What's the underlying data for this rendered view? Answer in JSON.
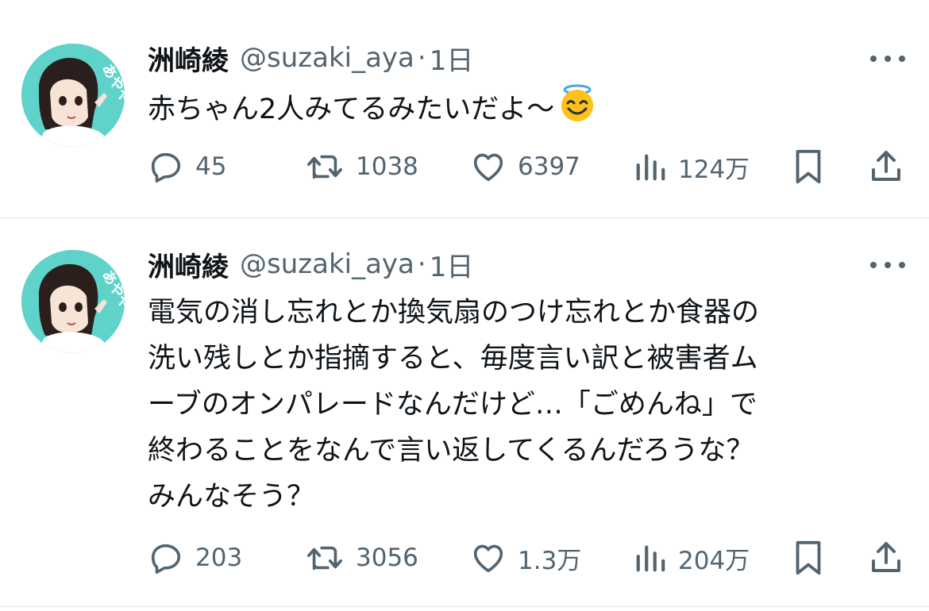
{
  "tweets": [
    {
      "author": {
        "name": "洲崎綾",
        "handle": "@suzaki_aya"
      },
      "separator": "·",
      "time": "1日",
      "text": "赤ちゃん2人みてるみたいだよ〜",
      "emoji": "smiling-face-with-halo",
      "stats": {
        "replies": "45",
        "retweets": "1038",
        "likes": "6397",
        "views": "124万"
      }
    },
    {
      "author": {
        "name": "洲崎綾",
        "handle": "@suzaki_aya"
      },
      "separator": "·",
      "time": "1日",
      "text_lines": [
        "電気の消し忘れとか換気扇のつけ忘れとか食器の",
        "洗い残しとか指摘すると、毎度言い訳と被害者ム",
        "ーブのオンパレードなんだけど…「ごめんね」で",
        "終わることをなんで言い返してくるんだろうな？",
        "みんなそう？"
      ],
      "stats": {
        "replies": "203",
        "retweets": "3056",
        "likes": "1.3万",
        "views": "204万"
      }
    }
  ],
  "colors": {
    "text": "#0f1419",
    "secondary": "#536471",
    "divider": "#e6e9ec",
    "avatar_bg": "#5fd3c9"
  },
  "icons": [
    "reply-icon",
    "retweet-icon",
    "like-icon",
    "views-icon",
    "bookmark-icon",
    "share-icon",
    "more-icon",
    "avatar"
  ]
}
